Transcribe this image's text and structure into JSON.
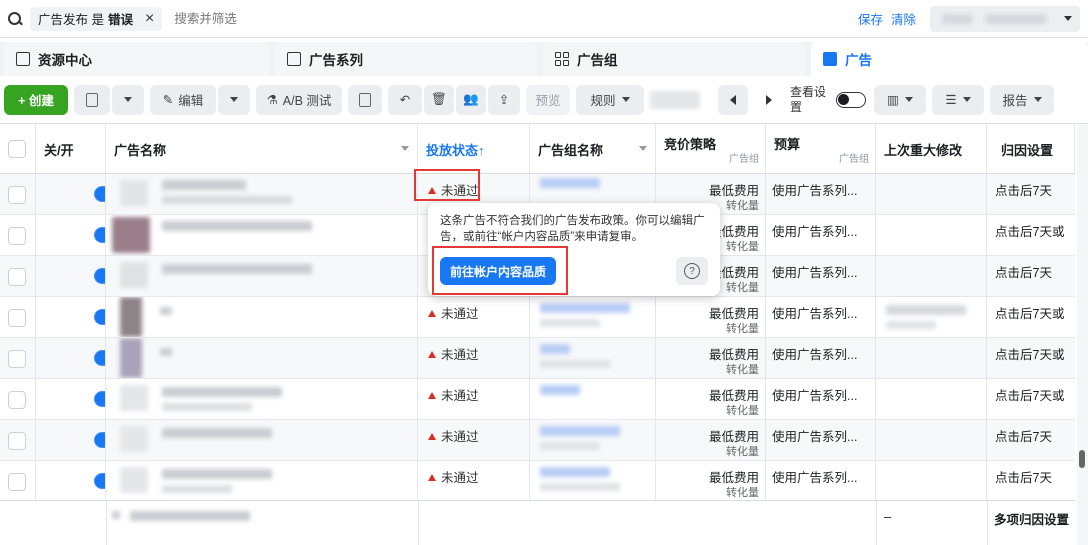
{
  "filter": {
    "chip_label": "广告发布 是",
    "chip_value": "错误",
    "search_placeholder": "搜索并筛选",
    "save": "保存",
    "clear": "清除"
  },
  "tabs": [
    {
      "label": "资源中心"
    },
    {
      "label": "广告系列"
    },
    {
      "label": "广告组"
    },
    {
      "label": "广告"
    }
  ],
  "toolbar": {
    "create": "+ 创建",
    "edit": "编辑",
    "ab_test": "A/B 测试",
    "preview": "预览",
    "rules": "规则",
    "view_settings": "查看设置",
    "report": "报告"
  },
  "columns": {
    "toggle": "关/开",
    "ad_name": "广告名称",
    "status": "投放状态",
    "adset_name": "广告组名称",
    "bid": "竞价策略",
    "bid_sub": "广告组",
    "budget": "预算",
    "budget_sub": "广告组",
    "last_edit": "上次重大修改",
    "attribution": "归因设置"
  },
  "rows": [
    {
      "status": "未通过",
      "bid": "最低费用",
      "bid_sub": "转化量",
      "budget": "使用广告系列...",
      "attribution": "点击后7天"
    },
    {
      "status": "",
      "bid": "最低费用",
      "bid_sub": "转化量",
      "budget": "使用广告系列...",
      "attribution": "点击后7天或"
    },
    {
      "status": "",
      "bid": "最低费用",
      "bid_sub": "转化量",
      "budget": "使用广告系列...",
      "attribution": "点击后7天"
    },
    {
      "status": "未通过",
      "bid": "最低费用",
      "bid_sub": "转化量",
      "budget": "使用广告系列...",
      "attribution": "点击后7天或"
    },
    {
      "status": "未通过",
      "bid": "最低费用",
      "bid_sub": "转化量",
      "budget": "使用广告系列...",
      "attribution": "点击后7天或"
    },
    {
      "status": "未通过",
      "bid": "最低费用",
      "bid_sub": "转化量",
      "budget": "使用广告系列...",
      "attribution": "点击后7天或"
    },
    {
      "status": "未通过",
      "bid": "最低费用",
      "bid_sub": "转化量",
      "budget": "使用广告系列...",
      "attribution": "点击后7天"
    },
    {
      "status": "未通过",
      "bid": "最低费用",
      "bid_sub": "转化量",
      "budget": "使用广告系列...",
      "attribution": "点击后7天"
    }
  ],
  "footer": {
    "last_edit": "–",
    "attribution": "多项归因设置"
  },
  "popover": {
    "message": "这条广告不符合我们的广告发布政策。你可以编辑广告，或前往“帐户内容品质”来申请复审。",
    "cta": "前往帐户内容品质",
    "help_icon": "?"
  },
  "colors": {
    "accent": "#1877f2",
    "create": "#36a420",
    "warning": "#d93025",
    "annotation": "#e53935"
  }
}
